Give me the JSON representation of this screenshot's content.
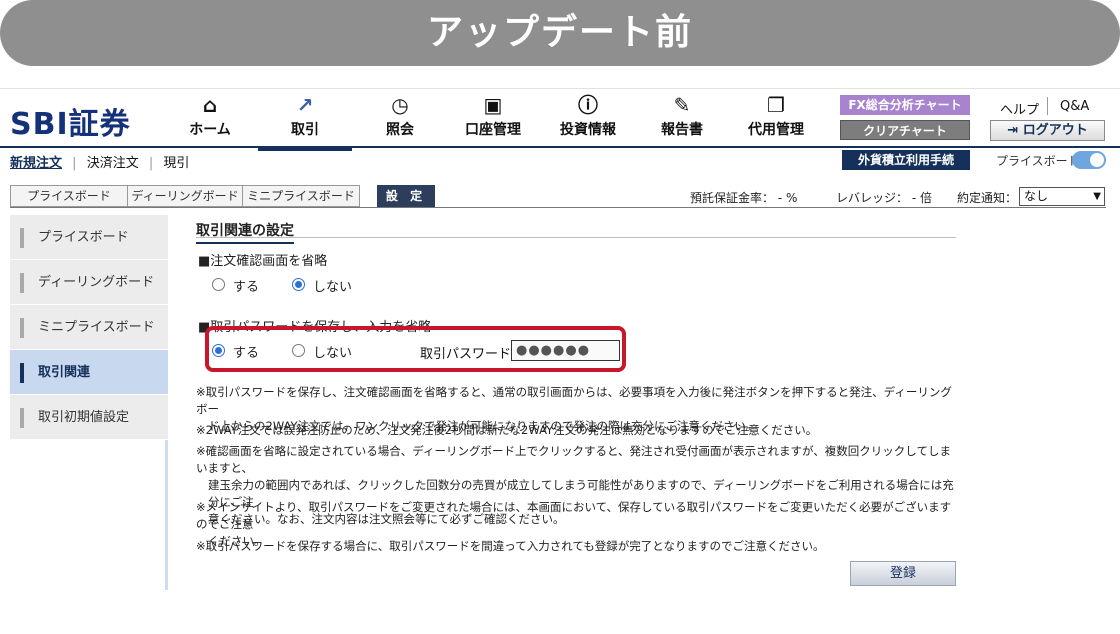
{
  "banner": {
    "title": "アップデート前"
  },
  "header": {
    "logo": "SBI証券",
    "nav": [
      {
        "label": "ホーム",
        "icon": "⌂"
      },
      {
        "label": "取引",
        "icon": "↗"
      },
      {
        "label": "照会",
        "icon": "◷"
      },
      {
        "label": "口座管理",
        "icon": "▣"
      },
      {
        "label": "投資情報",
        "icon": "ⓘ"
      },
      {
        "label": "報告書",
        "icon": "✎"
      },
      {
        "label": "代用管理",
        "icon": "❐"
      }
    ],
    "fx_button": "FX総合分析チャート",
    "clear_button": "クリアチャート",
    "help": "ヘルプ",
    "qa": "Q&A",
    "logout": "ログアウト",
    "logout_icon": "⇥"
  },
  "subnav": {
    "items": [
      "新規注文",
      "決済注文",
      "現引"
    ],
    "gaika_button": "外貨積立利用手続",
    "toggle_label": "プライスボード"
  },
  "tabs": [
    "プライスボード",
    "ディーリングボード",
    "ミニプライスボード",
    "設 定"
  ],
  "status": {
    "margin_rate": "預託保証金率： - %",
    "leverage": "レバレッジ： - 倍",
    "notify_label": "約定通知：",
    "notify_value": "なし"
  },
  "sidebar": [
    "プライスボード",
    "ディーリングボード",
    "ミニプライスボード",
    "取引関連",
    "取引初期値設定"
  ],
  "section": {
    "title": "取引関連の設定",
    "q1": "■注文確認画面を省略",
    "q1_yes": "する",
    "q1_no": "しない",
    "q2": "■取引パスワードを保存し、入力を省略",
    "q2_yes": "する",
    "q2_no": "しない",
    "pw_label": "取引パスワード",
    "pw_value": "●●●●●●"
  },
  "notes": [
    {
      "head": "※取引パスワードを保存し、注文確認画面を省略すると、通常の取引画面からは、必要事項を入力後に発注ボタンを押下すると発注、ディーリングボー",
      "cont": [
        "ド上からの2WAY注文では、ワンクリックで発注が可能になりますので発注の際は充分にご注意ください。"
      ]
    },
    {
      "head": "※2WAY注文では誤発注防止のため、注文発注後2秒間は新たな2WAY注文の発注は無効となりますのでご注意ください。",
      "cont": []
    },
    {
      "head": "※確認画面を省略に設定されている場合、ディーリングボード上でクリックすると、発注され受付画面が表示されますが、複数回クリックしてしまいますと、",
      "cont": [
        "建玉余力の範囲内であれば、クリックした回数分の売買が成立してしまう可能性がありますので、ディーリングボードをご利用される場合には充分にご注",
        "意ください。なお、注文内容は注文照会等にて必ずご確認ください。"
      ]
    },
    {
      "head": "※メインサイトより、取引パスワードをご変更された場合には、本画面において、保存している取引パスワードをご変更いただく必要がございますのでご注意",
      "cont": [
        "ください。"
      ]
    },
    {
      "head": "※取引パスワードを保存する場合に、取引パスワードを間違って入力されても登録が完了となりますのでご注意ください。",
      "cont": []
    }
  ],
  "register_button": "登録"
}
